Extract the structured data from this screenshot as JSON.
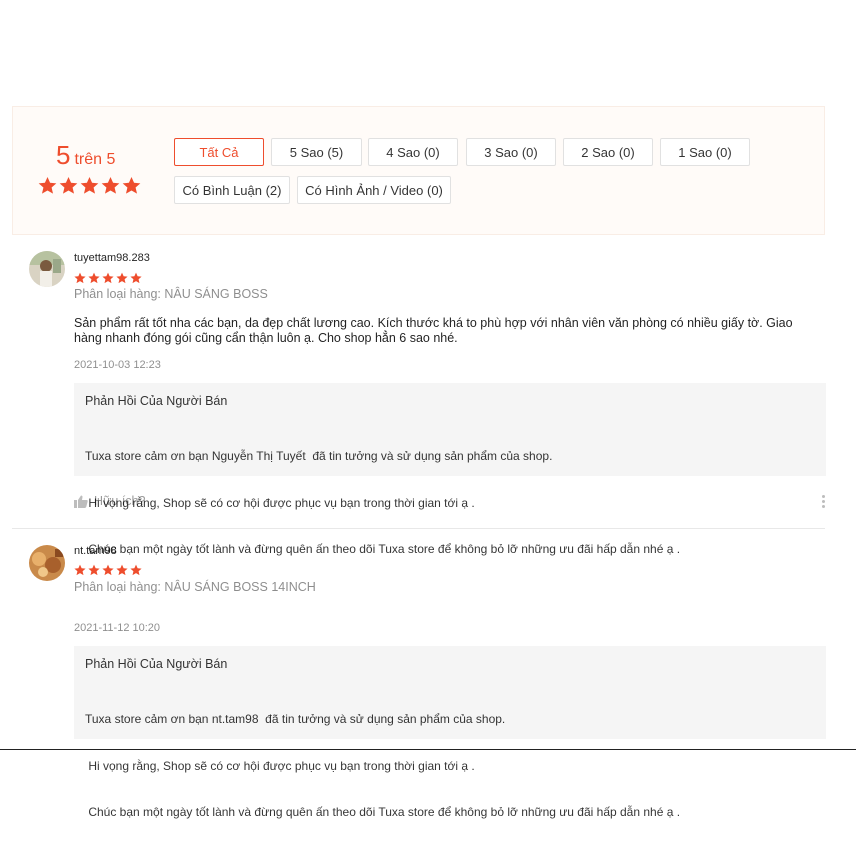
{
  "summary": {
    "score": "5",
    "out_of": "trên 5",
    "rating_stars": 5,
    "filters": [
      {
        "label": "Tất Cả",
        "active": true
      },
      {
        "label": "5 Sao (5)",
        "active": false
      },
      {
        "label": "4 Sao (0)",
        "active": false
      },
      {
        "label": "3 Sao (0)",
        "active": false
      },
      {
        "label": "2 Sao (0)",
        "active": false
      },
      {
        "label": "1 Sao (0)",
        "active": false
      },
      {
        "label": "Có Bình Luận (2)",
        "active": false
      },
      {
        "label": "Có Hình Ảnh / Video (0)",
        "active": false
      }
    ]
  },
  "reviews": [
    {
      "username": "tuyettam98.283",
      "stars": 5,
      "variation": "Phân loại hàng: NÂU SÁNG BOSS",
      "content_line1": "Sản phẩm rất tốt nha các bạn, da đẹp chất lương cao. Kích thước khá to phù hợp với nhân viên văn phòng có nhiều giấy tờ. Giao",
      "content_line2": "hàng nhanh đóng gói cũng cẩn thận luôn ạ. Cho shop hẳn 6 sao nhé.",
      "time": "2021-10-03 12:23",
      "reply_title": "Phản Hồi Của Người Bán",
      "reply_line1": "Tuxa store cảm ơn bạn Nguyễn Thị Tuyết  đã tin tưởng và sử dụng sản phẩm của shop.",
      "reply_line2": " Hi vọng rằng, Shop sẽ có cơ hội được phục vụ bạn trong thời gian tới ạ .",
      "reply_line3": " Chúc bạn một ngày tốt lành và đừng quên ấn theo dõi Tuxa store để không bỏ lỡ những ưu đãi hấp dẫn nhé ạ .",
      "helpful": "Hữu ích?"
    },
    {
      "username": "nt.tam98",
      "stars": 5,
      "variation": "Phân loại hàng: NÂU SÁNG BOSS 14INCH",
      "time": "2021-11-12 10:20",
      "reply_title": "Phản Hồi Của Người Bán",
      "reply_line1": "Tuxa store cảm ơn bạn nt.tam98  đã tin tưởng và sử dụng sản phẩm của shop.",
      "reply_line2": " Hi vọng rằng, Shop sẽ có cơ hội được phục vụ bạn trong thời gian tới ạ .",
      "reply_line3": " Chúc bạn một ngày tốt lành và đừng quên ấn theo dõi Tuxa store để không bỏ lỡ những ưu đãi hấp dẫn nhé ạ ."
    }
  ],
  "colors": {
    "accent": "#ee4d2d",
    "summary_bg": "#fffbf8",
    "reply_bg": "#f5f5f5"
  },
  "icons": {
    "star": "star-icon",
    "thumb": "thumbs-up-icon",
    "more": "more-vertical-icon"
  }
}
